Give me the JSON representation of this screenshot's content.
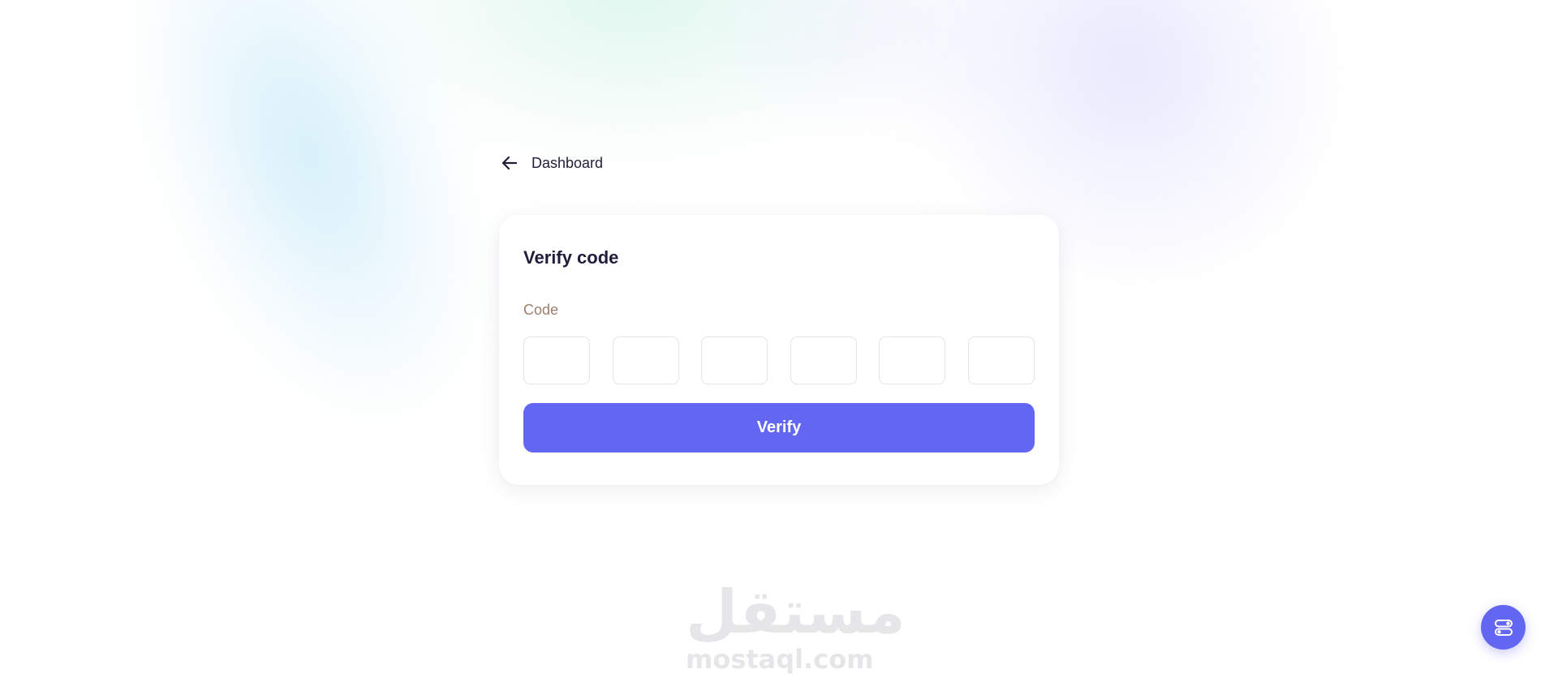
{
  "nav": {
    "back_label": "Dashboard",
    "back_icon": "arrow-left-icon"
  },
  "card": {
    "title": "Verify code",
    "code_label": "Code",
    "code_digits": [
      "",
      "",
      "",
      "",
      "",
      ""
    ],
    "verify_label": "Verify"
  },
  "watermark": {
    "arabic": "مستقل",
    "latin": "mostaql.com"
  },
  "fab": {
    "icon": "toggle-settings-icon"
  },
  "colors": {
    "accent": "#6366f1",
    "title_text": "#201d3a",
    "label_text": "#9c7f6e",
    "input_border": "#e3e3ea",
    "background": "#ffffff"
  }
}
